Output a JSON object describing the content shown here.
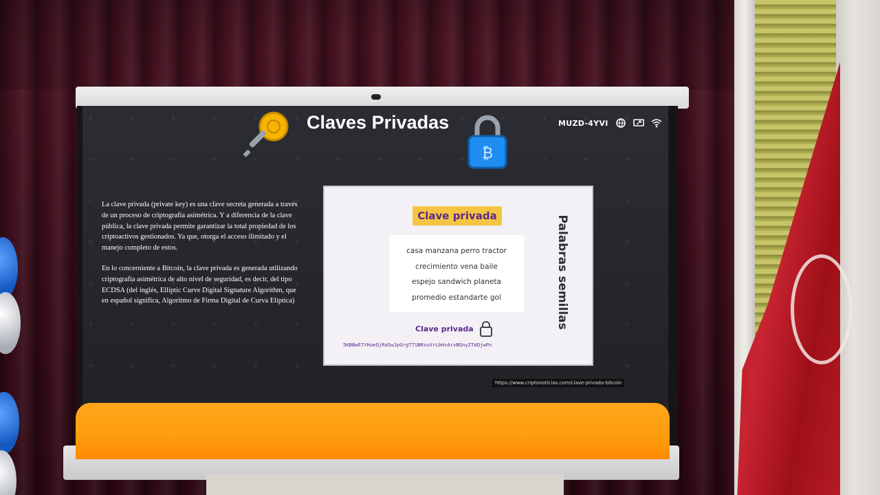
{
  "slide": {
    "title": "Claves Privadas",
    "room_code": "MUZD-4YVI",
    "description_p1": "La clave privada (private key) es una clave secreta generada a través de un proceso de criptografía asimétrica. Y a diferencia de la clave pública, la clave privada permite garantizar la total propiedad de los criptoactivos gestionados. Ya que, otorga el acceso ilimitado y el manejo completo de estos.",
    "description_p2": "En lo concerniente a Bitcoin, la clave privada es generada utilizando criptografía asimétrica de alto nivel de seguridad, es decir, del tipo ECDSA (del inglés, Elliptic Curve Digital Signature Algorithm, que en español significa, Algoritmo de Firma Digital de Curva Elíptica)",
    "card": {
      "title": "Clave privada",
      "seed_lines": [
        "casa manzana perro tractor",
        "crecimiento vena baile",
        "espejo sandwich planeta",
        "promedio estandarte gol"
      ],
      "sub_label": "Clave privada",
      "private_key": "5KBBwE7YHueQjRa5wJpGrgT7SBRzuVrLbHvArvBQnyZTdQjwPn",
      "side_label": "Palabras semillas"
    },
    "source_url": "https://www.criptonoticias.com/clave-privada-bitcoin"
  },
  "icons": {
    "key": "key-icon",
    "lock": "padlock-icon",
    "status": [
      "globe-icon",
      "screen-share-icon",
      "wifi-icon"
    ]
  },
  "colors": {
    "accent_orange": "#ff9e0f",
    "title_highlight": "#f5c542",
    "card_text_purple": "#5a2a8a",
    "flag_red": "#c92432"
  }
}
